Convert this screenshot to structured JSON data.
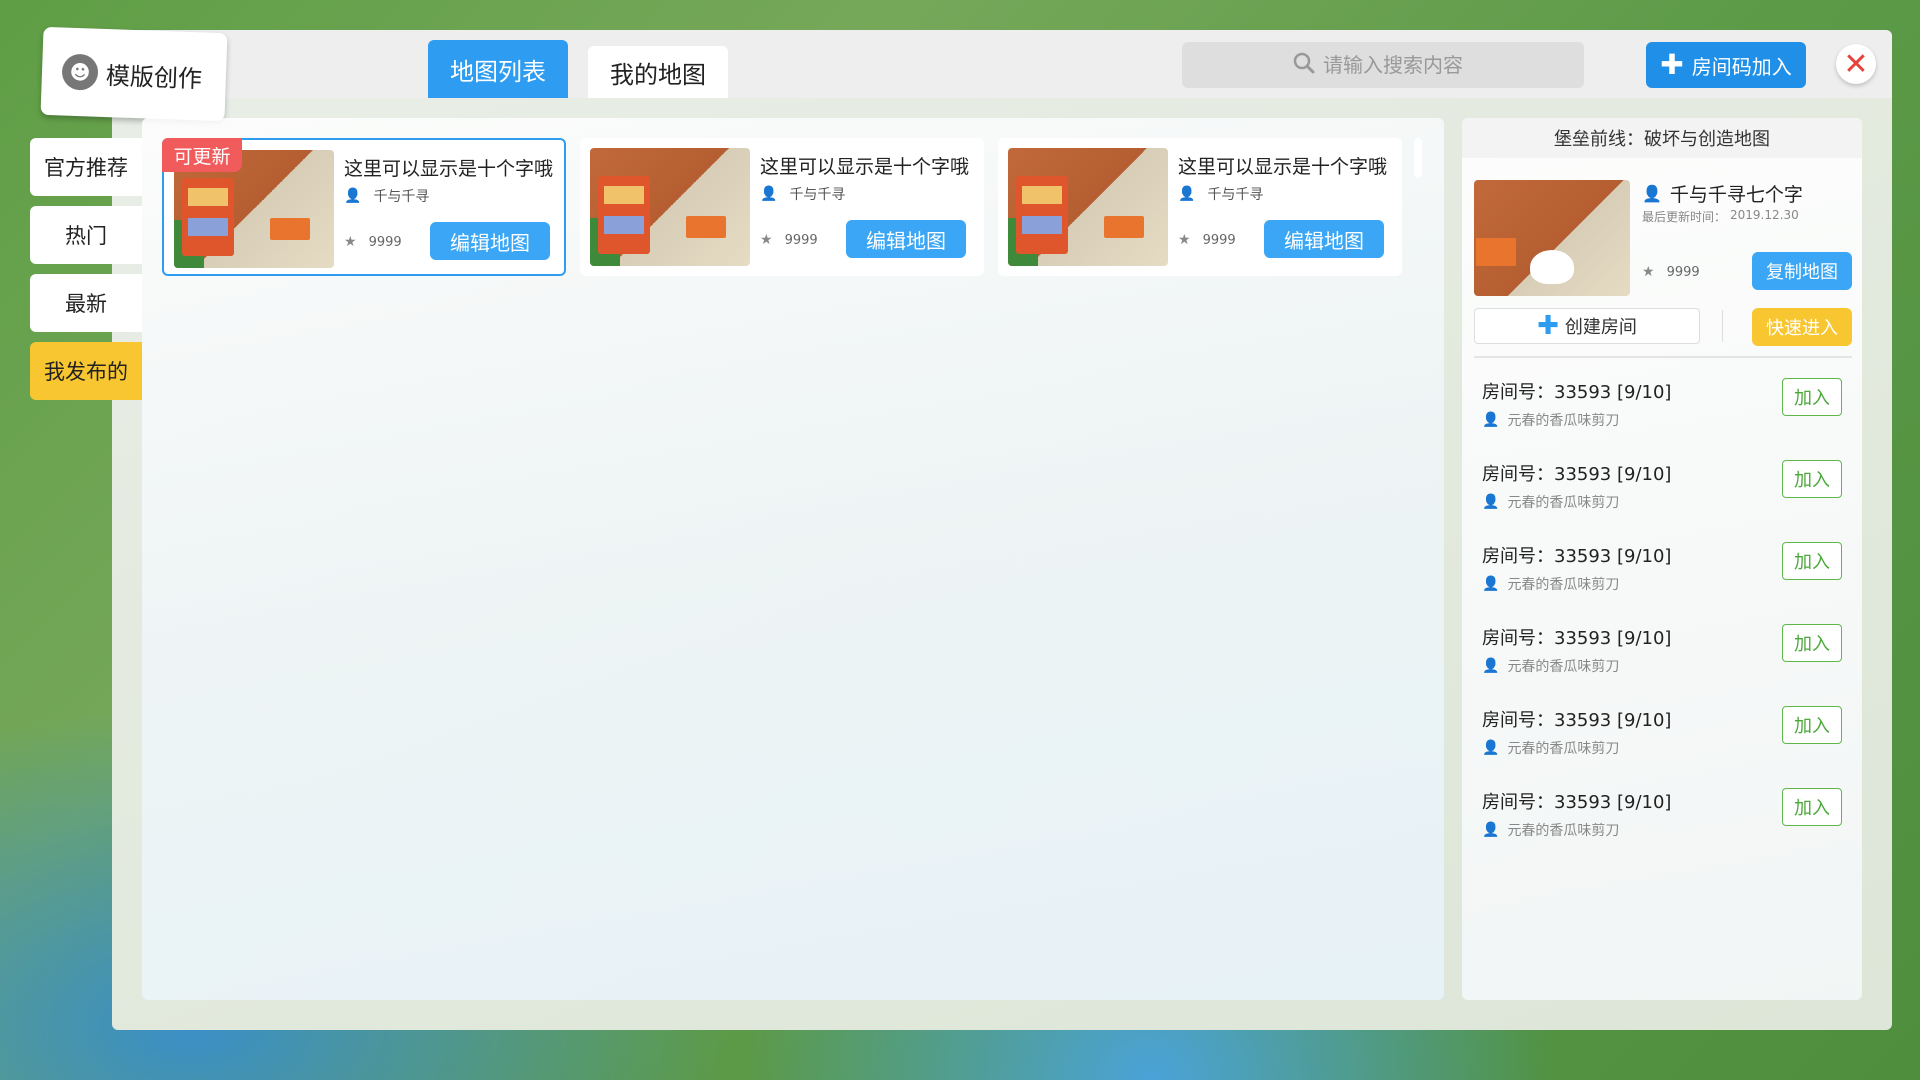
{
  "app": {
    "title": "模版创作"
  },
  "tabs": [
    {
      "label": "地图列表",
      "active": true
    },
    {
      "label": "我的地图",
      "active": false
    }
  ],
  "search": {
    "placeholder": "请输入搜索内容",
    "value": ""
  },
  "header": {
    "join_code_label": "房间码加入",
    "close_icon": "close-icon"
  },
  "sidebar": {
    "items": [
      {
        "label": "官方推荐",
        "active": false
      },
      {
        "label": "热门",
        "active": false
      },
      {
        "label": "最新",
        "active": false
      },
      {
        "label": "我发布的",
        "active": true
      }
    ]
  },
  "maps": [
    {
      "badge": "可更新",
      "name": "这里可以显示是十个字哦",
      "author": "千与千寻",
      "stars": "9999",
      "action": "编辑地图"
    },
    {
      "badge": "",
      "name": "这里可以显示是十个字哦",
      "author": "千与千寻",
      "stars": "9999",
      "action": "编辑地图"
    },
    {
      "badge": "",
      "name": "这里可以显示是十个字哦",
      "author": "千与千寻",
      "stars": "9999",
      "action": "编辑地图"
    }
  ],
  "detail": {
    "title": "堡垒前线：破坏与创造地图",
    "author": "千与千寻七个字",
    "updated_label": "最后更新时间：",
    "updated_date": "2019.12.30",
    "stars": "9999",
    "copy_label": "复制地图",
    "create_room_label": "创建房间",
    "quick_join_label": "快速进入"
  },
  "rooms": [
    {
      "id_text": "房间号：33593 [9/10]",
      "owner": "元春的香瓜味剪刀",
      "join_label": "加入"
    },
    {
      "id_text": "房间号：33593 [9/10]",
      "owner": "元春的香瓜味剪刀",
      "join_label": "加入"
    },
    {
      "id_text": "房间号：33593 [9/10]",
      "owner": "元春的香瓜味剪刀",
      "join_label": "加入"
    },
    {
      "id_text": "房间号：33593 [9/10]",
      "owner": "元春的香瓜味剪刀",
      "join_label": "加入"
    },
    {
      "id_text": "房间号：33593 [9/10]",
      "owner": "元春的香瓜味剪刀",
      "join_label": "加入"
    },
    {
      "id_text": "房间号：33593 [9/10]",
      "owner": "元春的香瓜味剪刀",
      "join_label": "加入"
    }
  ],
  "colors": {
    "accent": "#2e9cf0",
    "highlight": "#f8c630",
    "badge": "#f25b5b",
    "join": "#5cb84a"
  }
}
